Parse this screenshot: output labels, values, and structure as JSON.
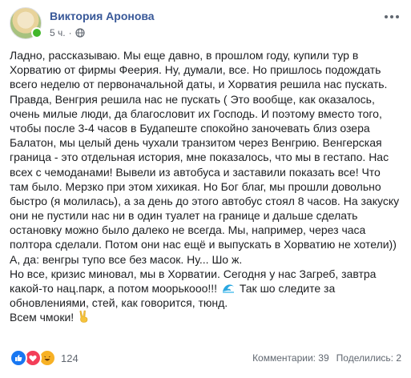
{
  "author": {
    "name": "Виктория Аронова"
  },
  "meta": {
    "time": "5 ч.",
    "separator": "·"
  },
  "post_lines": [
    "Ладно, рассказываю. Мы еще давно, в прошлом году, купили тур в",
    "Хорватию от фирмы Феерия. Ну, думали, все. Но пришлось подождать",
    "всего неделю от первоначальной даты, и Хорватия решила нас пускать.",
    "Правда, Венгрия решила нас не пускать ( Это вообще, как оказалось,",
    "очень милые люди, да благословит их Господь. И поэтому вместо того,",
    "чтобы после 3-4 часов в Будапеште спокойно заночевать близ озера",
    "Балатон, мы целый день чухали транзитом через Венгрию. Венгерская",
    "граница - это отдельная история, мне показалось, что мы в гестапо. Нас",
    "всех с чемоданами! Вывели из автобуса и заставили показать все! Что",
    "там было. Мерзко при этом хихикая. Но Бог благ, мы прошли довольно",
    "быстро (я молилась), а за день до этого автобус стоял 8 часов. На закуску",
    "они не пустили нас ни в один туалет на границе и дальше сделать",
    "остановку можно было далеко не всегда. Мы, например, через часа",
    "полтора сделали. Потом они нас ещё и выпускать в Хорватию не хотели))",
    "А, да: венгры тупо все без масок. Ну... Шо ж.",
    "Но все, кризис миновал, мы в Хорватии. Сегодня у нас Загреб, завтра",
    "какой-то нац.парк, а потом моорькооо!!!",
    "обновлениями, стей, как говорится, тюнд.",
    "Всем чмоки!"
  ],
  "post_line_17_tail": "Так шо следите за",
  "reactions": {
    "count": "124"
  },
  "stats": {
    "comments": "Комментарии: 39",
    "shares": "Поделились: 2"
  },
  "icons": {
    "wave": "wave-emoji-icon",
    "victory": "victory-hand-emoji-icon",
    "globe": "globe-icon",
    "like": "like-reaction-icon",
    "love": "love-reaction-icon",
    "haha": "haha-reaction-icon"
  }
}
